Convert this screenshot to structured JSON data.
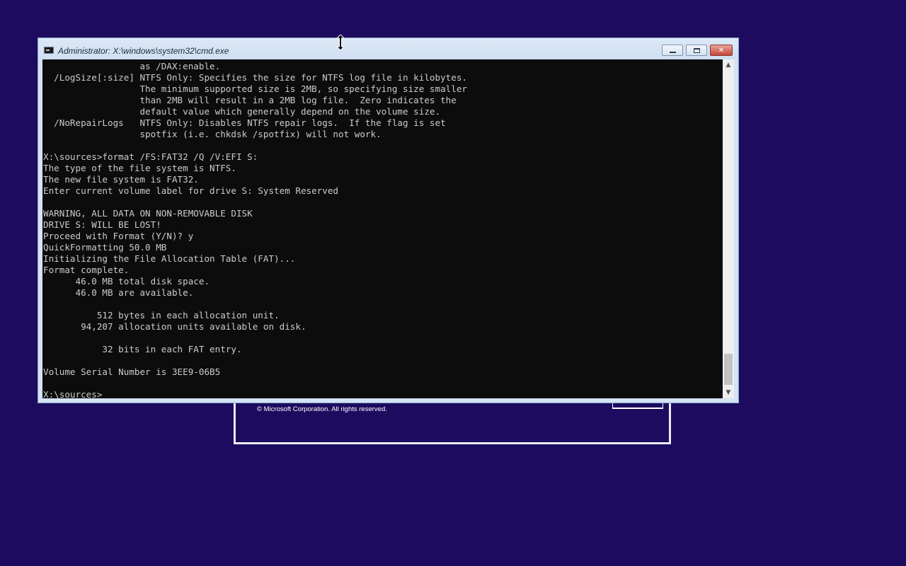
{
  "window": {
    "title": "Administrator: X:\\windows\\system32\\cmd.exe"
  },
  "background_dialog": {
    "copyright": "© Microsoft Corporation. All rights reserved."
  },
  "console": {
    "lines": [
      "                  as /DAX:enable.",
      "  /LogSize[:size] NTFS Only: Specifies the size for NTFS log file in kilobytes.",
      "                  The minimum supported size is 2MB, so specifying size smaller",
      "                  than 2MB will result in a 2MB log file.  Zero indicates the",
      "                  default value which generally depend on the volume size.",
      "  /NoRepairLogs   NTFS Only: Disables NTFS repair logs.  If the flag is set",
      "                  spotfix (i.e. chkdsk /spotfix) will not work.",
      "",
      "X:\\sources>format /FS:FAT32 /Q /V:EFI S:",
      "The type of the file system is NTFS.",
      "The new file system is FAT32.",
      "Enter current volume label for drive S: System Reserved",
      "",
      "WARNING, ALL DATA ON NON-REMOVABLE DISK",
      "DRIVE S: WILL BE LOST!",
      "Proceed with Format (Y/N)? y",
      "QuickFormatting 50.0 MB",
      "Initializing the File Allocation Table (FAT)...",
      "Format complete.",
      "      46.0 MB total disk space.",
      "      46.0 MB are available.",
      "",
      "          512 bytes in each allocation unit.",
      "       94,207 allocation units available on disk.",
      "",
      "           32 bits in each FAT entry.",
      "",
      "Volume Serial Number is 3EE9-06B5",
      "",
      "X:\\sources>"
    ]
  },
  "colors": {
    "desktop": "#1d0b5f",
    "console_bg": "#0c0c0c",
    "console_fg": "#cccccc",
    "close_button": "#c7463a"
  },
  "icons": {
    "window_icon": "cmd-icon",
    "minimize": "minimize-icon",
    "maximize": "maximize-icon",
    "close": "close-icon",
    "cursor": "resize-vertical-cursor-icon"
  },
  "scrollbar": {
    "position_fraction": 1.0
  }
}
